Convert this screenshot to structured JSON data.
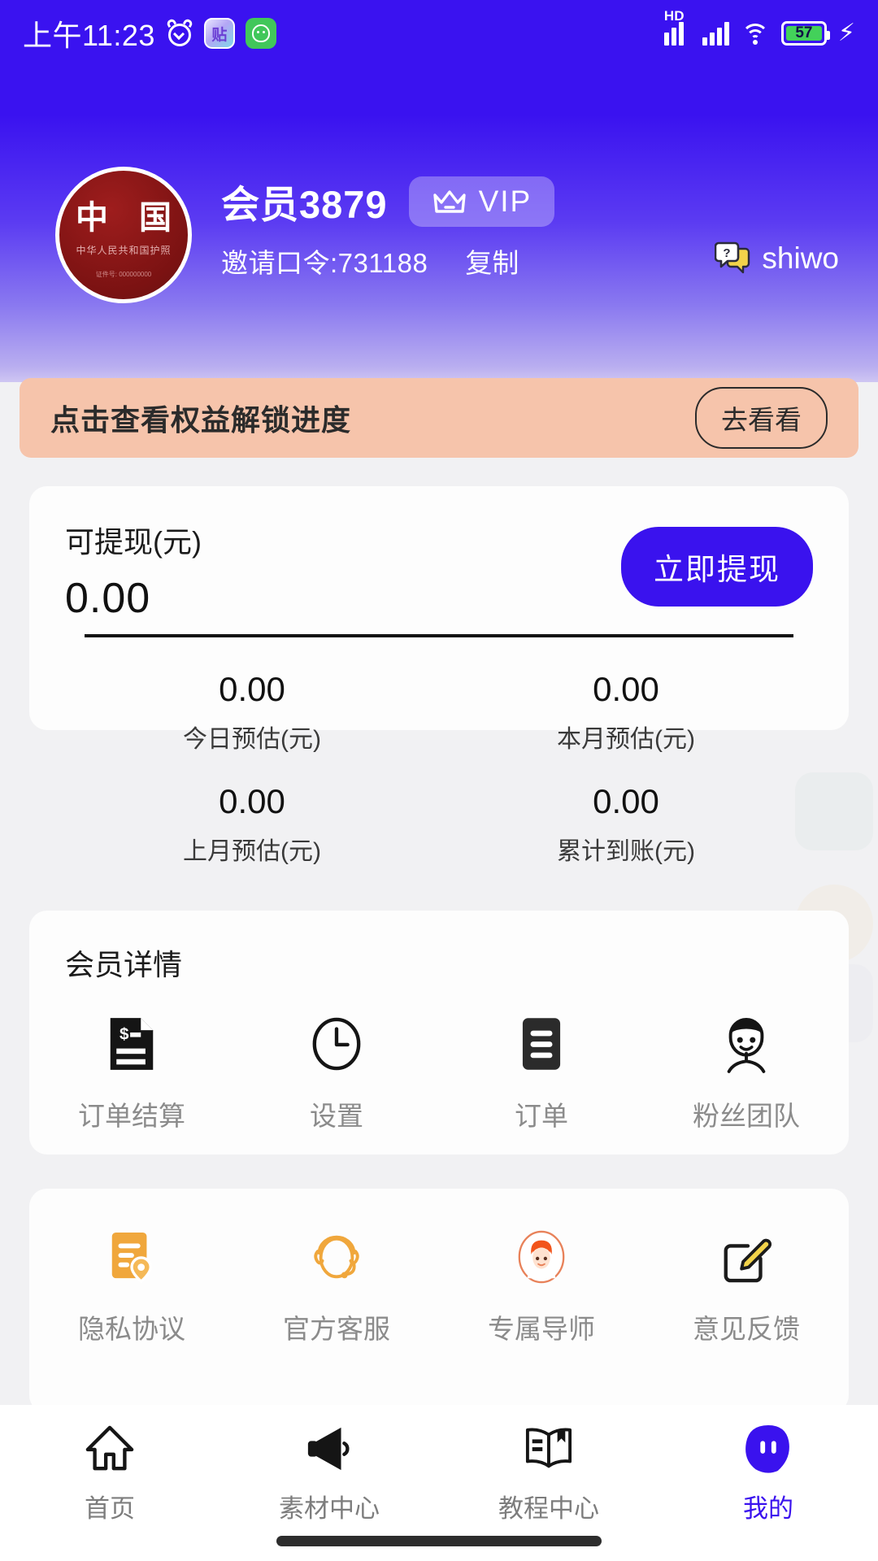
{
  "status_bar": {
    "time": "上午11:23",
    "icons": [
      "alarm-clock-icon",
      "tie-app-icon",
      "green-face-app-icon"
    ],
    "tie_glyph": "贴",
    "hd_label": "HD",
    "battery_percent": "57",
    "charging": true
  },
  "profile": {
    "avatar_main_text": "中 国",
    "avatar_sub_text": "中华人民共和国护照",
    "avatar_tiny_text": "证件号: 000000000",
    "username": "会员3879",
    "vip_label": "VIP",
    "vip_icon": "crown-icon",
    "invite_code": "邀请口令:731188",
    "copy_label": "复制",
    "help_label": "shiwo",
    "help_icon": "question-bubble-icon"
  },
  "banner": {
    "text": "点击查看权益解锁进度",
    "button_label": "去看看"
  },
  "wallet": {
    "label": "可提现(元)",
    "amount": "0.00",
    "withdraw_button": "立即提现",
    "stats": [
      {
        "value": "0.00",
        "label": "今日预估(元)"
      },
      {
        "value": "0.00",
        "label": "本月预估(元)"
      },
      {
        "value": "0.00",
        "label": "上月预估(元)"
      },
      {
        "value": "0.00",
        "label": "累计到账(元)"
      }
    ]
  },
  "member_detail": {
    "title": "会员详情",
    "items": [
      {
        "label": "订单结算",
        "icon": "invoice-icon"
      },
      {
        "label": "设置",
        "icon": "clock-icon"
      },
      {
        "label": "订单",
        "icon": "list-icon"
      },
      {
        "label": "粉丝团队",
        "icon": "person-icon"
      }
    ]
  },
  "services": {
    "items": [
      {
        "label": "隐私协议",
        "icon": "privacy-document-icon"
      },
      {
        "label": "官方客服",
        "icon": "headset-icon"
      },
      {
        "label": "专属导师",
        "icon": "mentor-avatar-icon"
      },
      {
        "label": "意见反馈",
        "icon": "edit-feedback-icon"
      }
    ]
  },
  "tabbar": {
    "items": [
      {
        "label": "首页",
        "icon": "home-icon",
        "active": false
      },
      {
        "label": "素材中心",
        "icon": "megaphone-icon",
        "active": false
      },
      {
        "label": "教程中心",
        "icon": "book-icon",
        "active": false
      },
      {
        "label": "我的",
        "icon": "profile-blob-icon",
        "active": true
      }
    ]
  },
  "colors": {
    "header_top": "#3a12f0",
    "header_bottom": "#cfc6f2",
    "accent": "#3a12ee",
    "banner_bg": "#f6c4ab",
    "page_bg": "#f1f1f3",
    "card_bg": "#fdfdfd",
    "avatar_red": "#7b1212",
    "battery_green": "#43d15a",
    "orange_icon": "#f0a73c"
  }
}
